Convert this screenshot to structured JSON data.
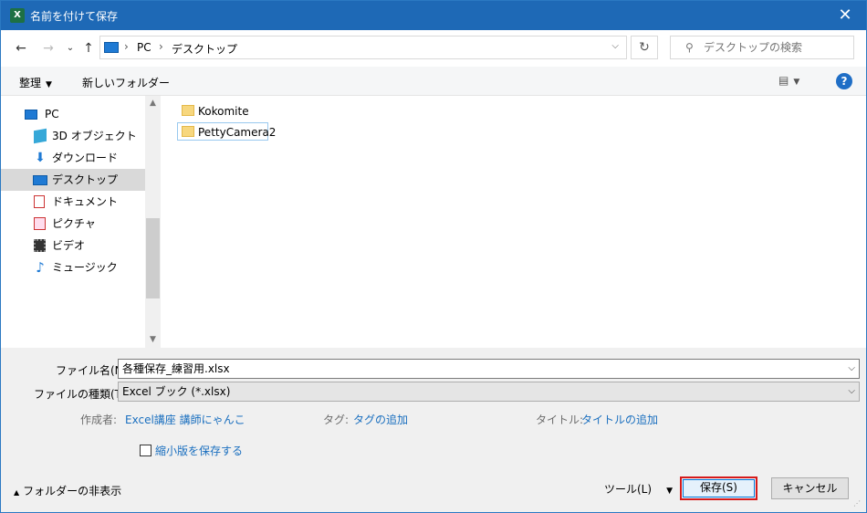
{
  "window": {
    "title": "名前を付けて保存",
    "app_icon": "X",
    "close_glyph": "✕"
  },
  "nav": {
    "back": "←",
    "forward": "→",
    "recent": "⌄",
    "up": "↑",
    "crumbs": [
      "PC",
      "デスクトップ"
    ],
    "crumb_sep": "›",
    "dropdown_glyph": "⌵",
    "refresh_glyph": "↻",
    "search_placeholder": "デスクトップの検索",
    "search_glyph": "⚲"
  },
  "toolbar": {
    "organize": "整理",
    "new_folder": "新しいフォルダー",
    "view_glyph": "▤",
    "help_glyph": "?"
  },
  "sidebar": {
    "items": [
      {
        "label": "PC",
        "icon": "pc-icon"
      },
      {
        "label": "3D オブジェクト",
        "icon": "cube-icon"
      },
      {
        "label": "ダウンロード",
        "icon": "download-icon"
      },
      {
        "label": "デスクトップ",
        "icon": "desktop-icon",
        "selected": true
      },
      {
        "label": "ドキュメント",
        "icon": "document-icon"
      },
      {
        "label": "ピクチャ",
        "icon": "picture-icon"
      },
      {
        "label": "ビデオ",
        "icon": "video-icon"
      },
      {
        "label": "ミュージック",
        "icon": "music-icon"
      }
    ],
    "scroll_up": "▲",
    "scroll_down": "▼"
  },
  "files": [
    {
      "name": "Kokomite"
    },
    {
      "name": "PettyCamera2"
    }
  ],
  "form": {
    "filename_label": "ファイル名(N):",
    "filename_value": "各種保存_練習用.xlsx",
    "filetype_label": "ファイルの種類(T):",
    "filetype_value": "Excel ブック (*.xlsx)",
    "author_label": "作成者:",
    "author_value": "Excel講座 講師にゃんこ",
    "tags_label": "タグ:",
    "tags_value": "タグの追加",
    "title_label": "タイトル:",
    "title_value": "タイトルの追加",
    "thumbnail_label": "縮小版を保存する",
    "dropdown_glyph": "⌵"
  },
  "footer": {
    "hide_folders": "フォルダーの非表示",
    "hide_glyph": "▲",
    "tools": "ツール(L)",
    "tools_caret": "▼",
    "save": "保存(S)",
    "cancel": "キャンセル"
  },
  "colors": {
    "titlebar": "#1e69b6",
    "link": "#1a6fbf",
    "highlight_border": "#d61a1a"
  }
}
